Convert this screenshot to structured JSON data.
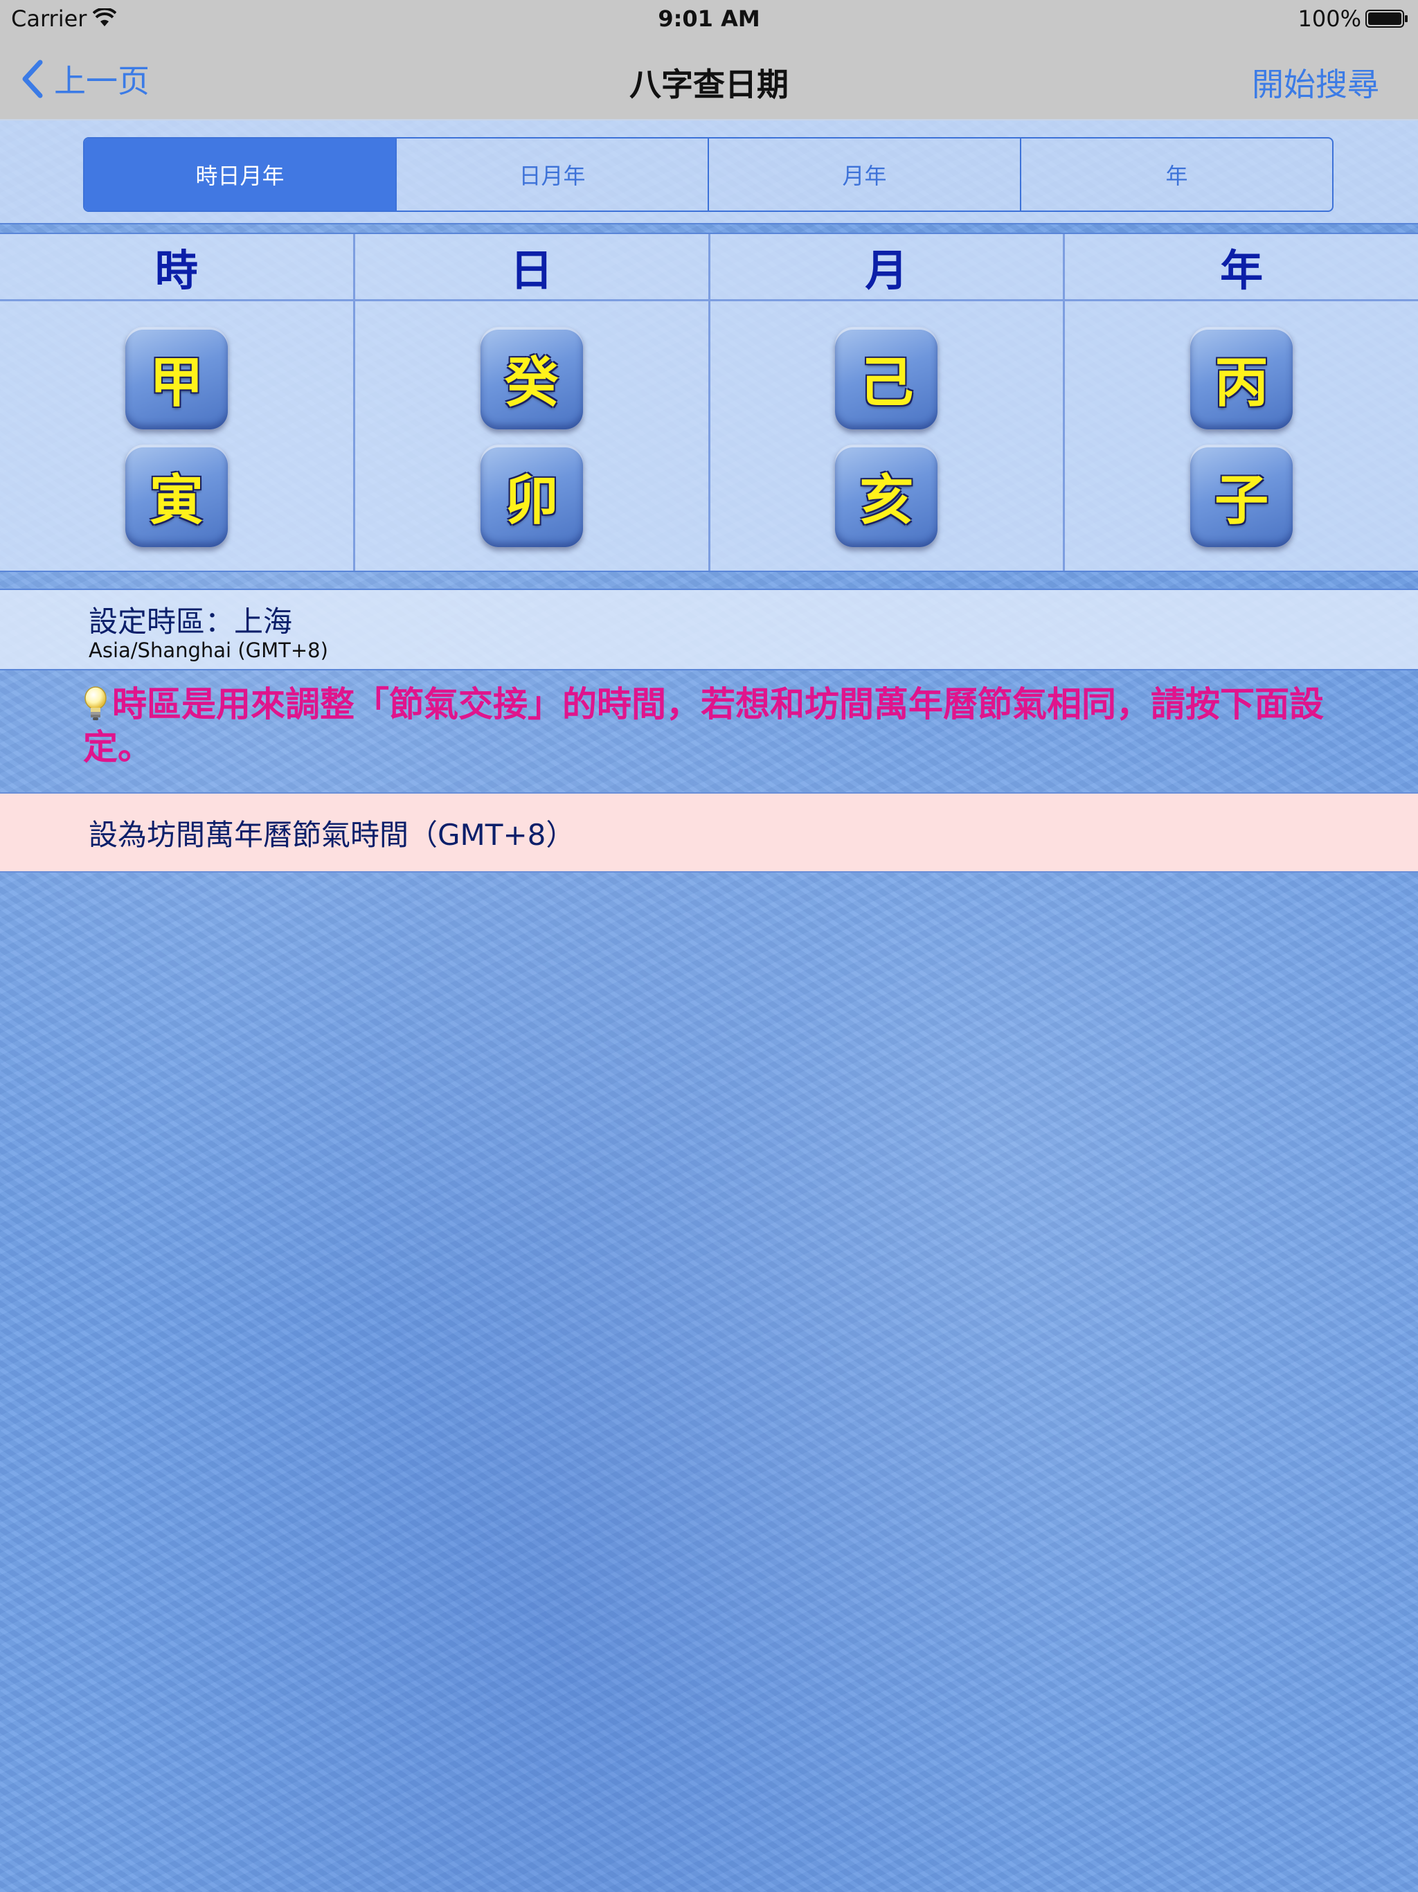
{
  "status_bar": {
    "carrier": "Carrier",
    "time": "9:01 AM",
    "battery": "100%"
  },
  "nav": {
    "back_label": "上一页",
    "title": "八字查日期",
    "search_label": "開始搜尋"
  },
  "segments": [
    {
      "label": "時日月年",
      "active": true
    },
    {
      "label": "日月年",
      "active": false
    },
    {
      "label": "月年",
      "active": false
    },
    {
      "label": "年",
      "active": false
    }
  ],
  "pillars": [
    {
      "header": "時",
      "stem": "甲",
      "branch": "寅"
    },
    {
      "header": "日",
      "stem": "癸",
      "branch": "卯"
    },
    {
      "header": "月",
      "stem": "己",
      "branch": "亥"
    },
    {
      "header": "年",
      "stem": "丙",
      "branch": "子"
    }
  ],
  "timezone": {
    "label": "設定時區：上海",
    "sub": "Asia/Shanghai (GMT+8)"
  },
  "tip": {
    "text": "時區是用來調整「節氣交接」的時間，若想和坊間萬年曆節氣相同，請按下面設定。"
  },
  "action": {
    "label": "設為坊間萬年曆節氣時間（GMT+8）"
  },
  "colors": {
    "accent": "#3b7be6",
    "tip": "#e0148c",
    "tile_text": "#fff21a",
    "header_text": "#0b1fa8"
  }
}
